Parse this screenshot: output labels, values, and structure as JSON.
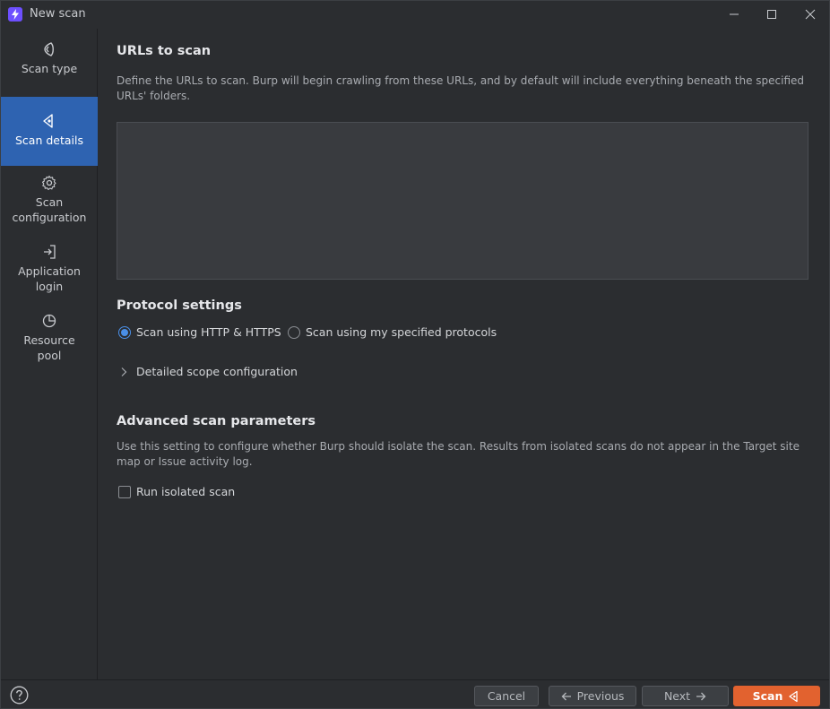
{
  "window": {
    "title": "New scan"
  },
  "sidebar": {
    "items": [
      {
        "label_1": "Scan type",
        "label_2": ""
      },
      {
        "label_1": "Scan details",
        "label_2": ""
      },
      {
        "label_1": "Scan",
        "label_2": "configuration"
      },
      {
        "label_1": "Application",
        "label_2": "login"
      },
      {
        "label_1": "Resource",
        "label_2": "pool"
      }
    ],
    "active_index": 1
  },
  "urls": {
    "heading": "URLs to scan",
    "description": "Define the URLs to scan. Burp will begin crawling from these URLs, and by default will include everything beneath the specified URLs' folders.",
    "value": ""
  },
  "protocol": {
    "heading": "Protocol settings",
    "option_http_https": "Scan using HTTP & HTTPS",
    "option_specified": "Scan using my specified protocols",
    "selected": "http_https",
    "detailed_scope": "Detailed scope configuration"
  },
  "advanced": {
    "heading": "Advanced scan parameters",
    "description": "Use this setting to configure whether Burp should isolate the scan. Results from isolated scans do not appear in the Target site map or Issue activity log.",
    "isolated_label": "Run isolated scan",
    "isolated_checked": false
  },
  "footer": {
    "help_icon": "help-icon",
    "cancel": "Cancel",
    "previous": "Previous",
    "next": "Next",
    "scan": "Scan"
  },
  "colors": {
    "accent": "#2e63b1",
    "primary_button": "#e2622f",
    "radio_selected": "#4a8fe7",
    "app_icon": "#6d4fff"
  }
}
